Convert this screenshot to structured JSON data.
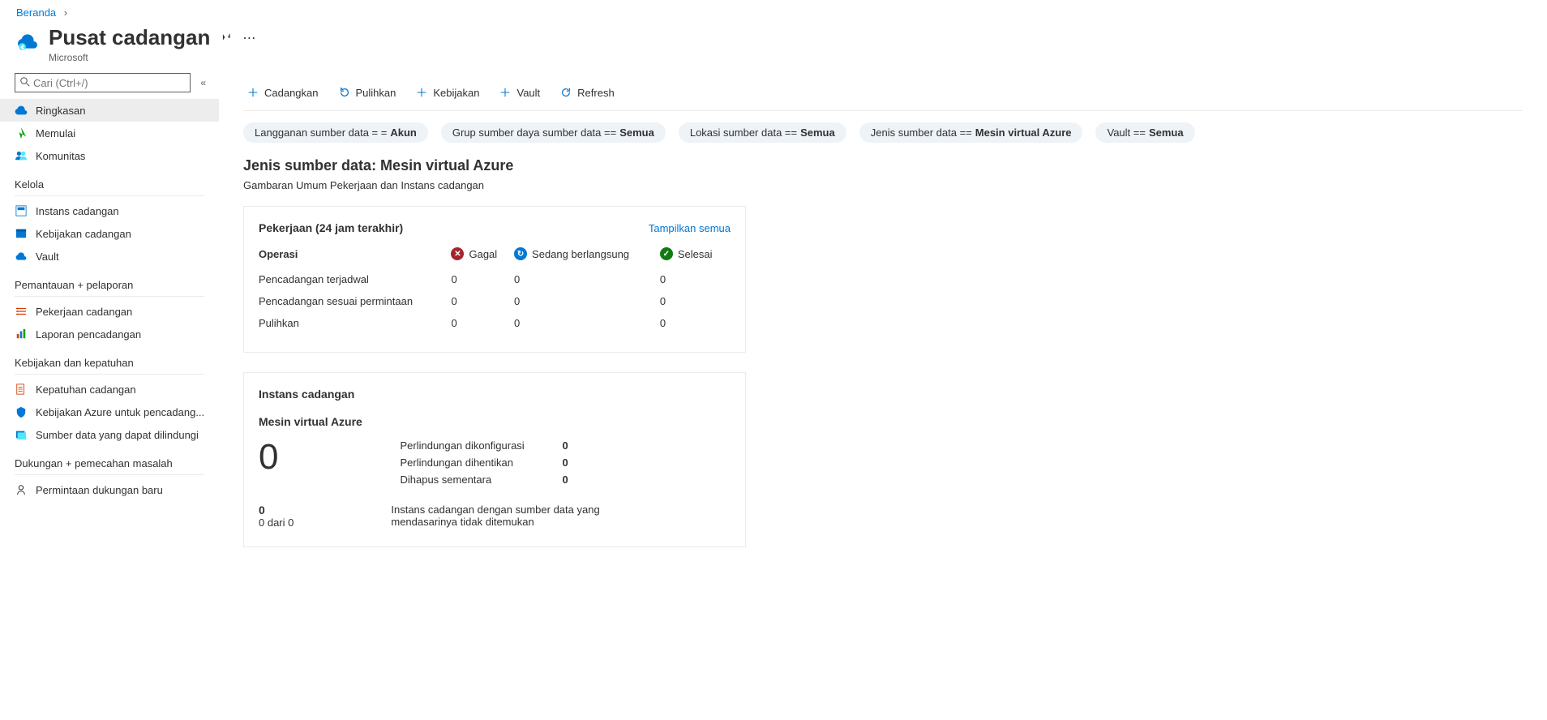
{
  "breadcrumb": {
    "home": "Beranda"
  },
  "header": {
    "title": "Pusat cadangan",
    "org": "Microsoft"
  },
  "sidebar": {
    "search_placeholder": "Cari (Ctrl+/)",
    "items_top": [
      {
        "label": "Ringkasan"
      },
      {
        "label": "Memulai"
      },
      {
        "label": "Komunitas"
      }
    ],
    "section_kelola": "Kelola",
    "items_kelola": [
      {
        "label": "Instans cadangan"
      },
      {
        "label": "Kebijakan cadangan"
      },
      {
        "label": "Vault"
      }
    ],
    "section_pemantauan": "Pemantauan + pelaporan",
    "items_pemantauan": [
      {
        "label": "Pekerjaan cadangan"
      },
      {
        "label": "Laporan pencadangan"
      }
    ],
    "section_kebijakan": "Kebijakan dan kepatuhan",
    "items_kebijakan": [
      {
        "label": "Kepatuhan cadangan"
      },
      {
        "label": "Kebijakan Azure untuk pencadang..."
      },
      {
        "label": "Sumber data yang dapat dilindungi"
      }
    ],
    "section_dukungan": "Dukungan + pemecahan masalah",
    "items_dukungan": [
      {
        "label": "Permintaan dukungan baru"
      }
    ]
  },
  "toolbar": {
    "backup": "Cadangkan",
    "restore": "Pulihkan",
    "policy": "Kebijakan",
    "vault": "Vault",
    "refresh": "Refresh"
  },
  "filters": {
    "f1_label": "Langganan sumber data = = ",
    "f1_value": "Akun",
    "f2_label": "Grup sumber daya sumber data == ",
    "f2_value": "Semua",
    "f3_label": "Lokasi sumber data == ",
    "f3_value": "Semua",
    "f4_label": "Jenis sumber data == ",
    "f4_value": "Mesin virtual Azure",
    "f5_label": "Vault == ",
    "f5_value": "Semua"
  },
  "datasource": {
    "heading": "Jenis sumber data: Mesin virtual Azure",
    "sub": "Gambaran Umum Pekerjaan dan Instans cadangan"
  },
  "jobs_card": {
    "title": "Pekerjaan (24 jam terakhir)",
    "show_all": "Tampilkan semua",
    "col_operation": "Operasi",
    "col_failed": "Gagal",
    "col_inprogress": "Sedang berlangsung",
    "col_done": "Selesai",
    "rows": [
      {
        "op": "Pencadangan terjadwal",
        "fail": "0",
        "prog": "0",
        "done": "0"
      },
      {
        "op": "Pencadangan sesuai permintaan",
        "fail": "0",
        "prog": "0",
        "done": "0"
      },
      {
        "op": "Pulihkan",
        "fail": "0",
        "prog": "0",
        "done": "0"
      }
    ]
  },
  "instances_card": {
    "title": "Instans cadangan",
    "subtitle": "Mesin virtual Azure",
    "big_number": "0",
    "rows": [
      {
        "label": "Perlindungan dikonfigurasi",
        "value": "0"
      },
      {
        "label": "Perlindungan dihentikan",
        "value": "0"
      },
      {
        "label": "Dihapus sementara",
        "value": "0"
      }
    ],
    "footer_count": "0",
    "footer_sub": "0 dari 0",
    "footer_desc": "Instans cadangan dengan sumber data yang mendasarinya tidak ditemukan"
  }
}
